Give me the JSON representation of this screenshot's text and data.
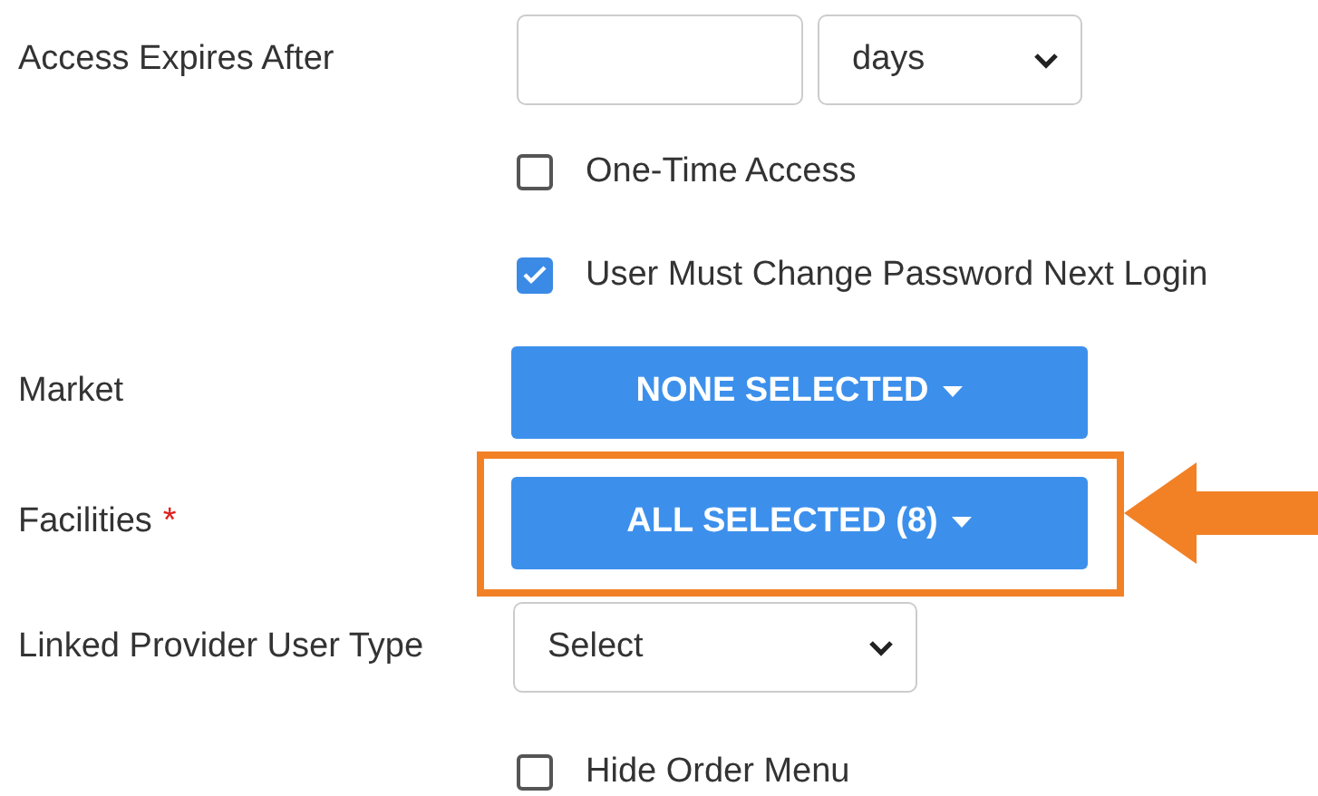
{
  "rows": [
    {
      "kind": "duration",
      "label": "Access Expires After",
      "value_placeholder": "",
      "unit": "days"
    },
    {
      "kind": "checkbox",
      "text": "One-Time Access",
      "checked": false
    },
    {
      "kind": "checkbox",
      "text": "User Must Change Password Next Login",
      "checked": true
    },
    {
      "kind": "multiselect",
      "label": "Market",
      "button": "NONE SELECTED",
      "highlighted": false
    },
    {
      "kind": "multiselect",
      "label": "Facilities",
      "required_mark": "*",
      "button": "ALL SELECTED (8)",
      "highlighted": true
    },
    {
      "kind": "select",
      "label": "Linked Provider User Type",
      "value": "Select"
    },
    {
      "kind": "checkbox",
      "text": "Hide Order Menu",
      "checked": false
    }
  ]
}
